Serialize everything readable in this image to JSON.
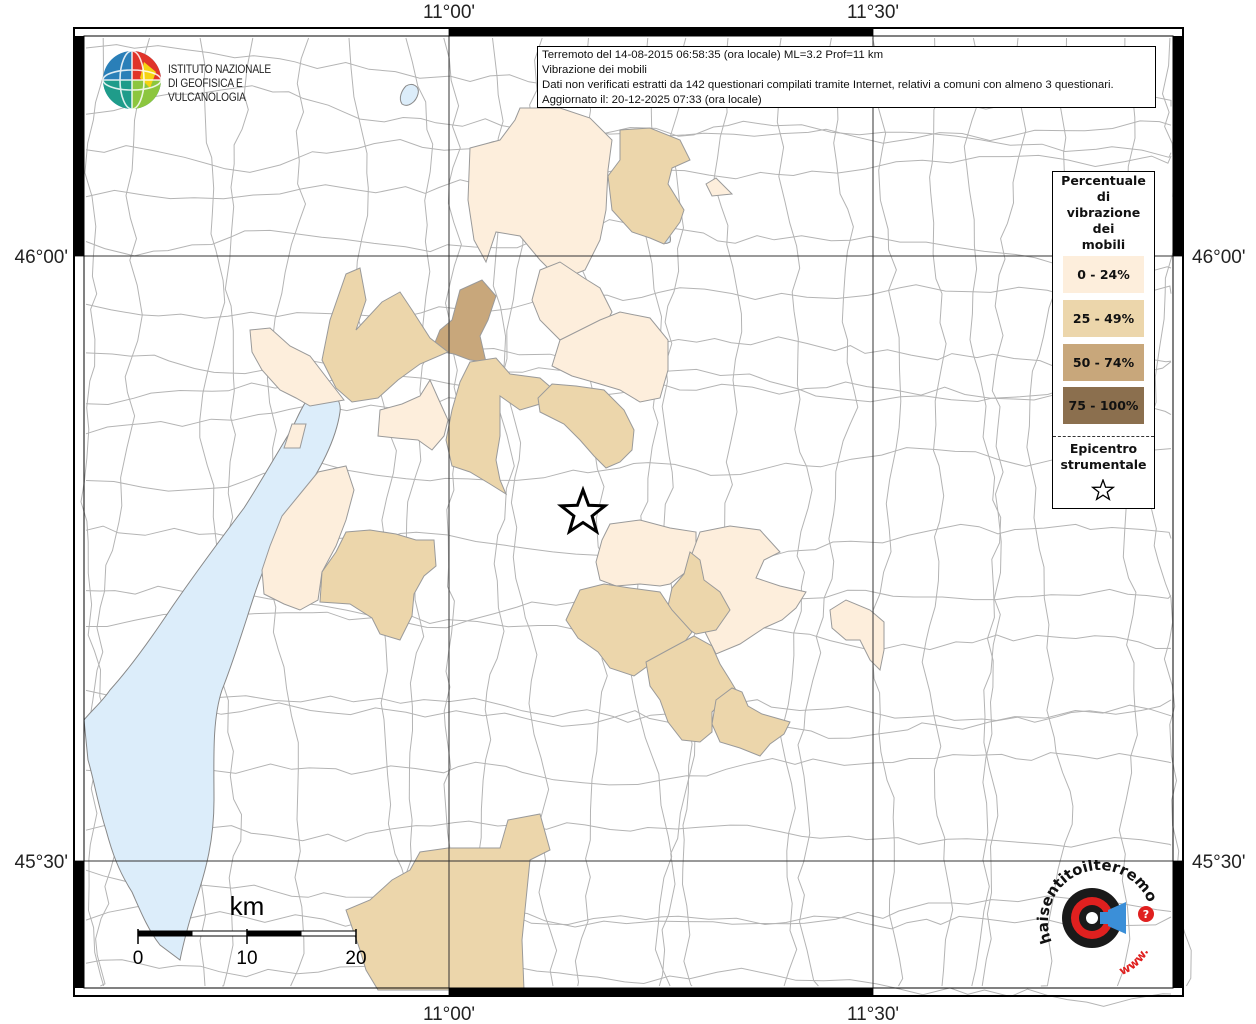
{
  "info": {
    "line1": "Terremoto del 14-08-2015 06:58:35 (ora locale) ML=3.2 Prof=11 km",
    "line2": "Vibrazione dei mobili",
    "line3": "Dati non verificati estratti da 142 questionari compilati tramite Internet, relativi a comuni con almeno 3 questionari.",
    "line4": "Aggiornato il: 20-12-2025 07:33 (ora locale)"
  },
  "ticks": {
    "lon_1100": "11°00'",
    "lon_1130": "11°30'",
    "lat_4600": "46°00'",
    "lat_4530": "45°30'"
  },
  "legend": {
    "title_lines": [
      "Percentuale",
      "di",
      "vibrazione",
      "dei",
      "mobili"
    ],
    "items": [
      {
        "label": "0 - 24%",
        "color": "#fdeedc"
      },
      {
        "label": "25 - 49%",
        "color": "#ecd6ab"
      },
      {
        "label": "50 - 74%",
        "color": "#c8a77b"
      },
      {
        "label": "75 - 100%",
        "color": "#8b6f4e"
      }
    ],
    "epicenter_lines": [
      "Epicentro",
      "strumentale"
    ]
  },
  "scale_bar": {
    "unit": "km",
    "labels": [
      "0",
      "10",
      "20"
    ]
  },
  "logos": {
    "ingv_line1": "ISTITUTO NAZIONALE",
    "ingv_line2": "DI GEOFISICA E VULCANOLOGIA",
    "hst_text": "haisentitoilterremoto.it",
    "hst_www": "www."
  },
  "colors": {
    "water": "#dcedfa",
    "class_0_24": "#fdeedc",
    "class_25_49": "#ecd6ab",
    "class_50_74": "#c8a77b",
    "class_75_100": "#8b6f4e",
    "boundary": "#b4b4b4"
  }
}
